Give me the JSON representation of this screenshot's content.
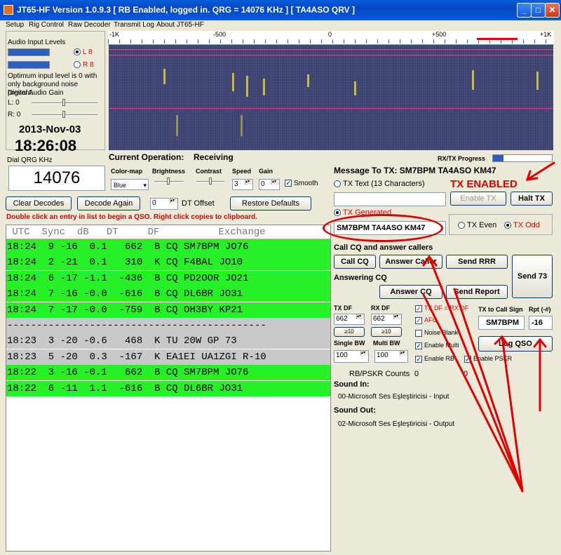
{
  "window": {
    "title": "JT65-HF Version 1.0.9.3  [ RB Enabled, logged in.  QRG = 14076 KHz ] [ TA4ASO QRV ]"
  },
  "menu": [
    "Setup",
    "Rig Control",
    "Raw Decoder",
    "Transmit Log",
    "About JT65-HF"
  ],
  "spectrum": {
    "ticks": [
      "-1K",
      "-500",
      "0",
      "+500",
      "+1K"
    ]
  },
  "audio": {
    "title": "Audio Input Levels",
    "left_label": "L 8",
    "right_label": "R 8",
    "hint": "Optimum input level is 0 with only background noise present.",
    "gain_title": "Digital Audio Gain",
    "gain_l": "L: 0",
    "gain_r": "R: 0"
  },
  "clock": {
    "date": "2013-Nov-03",
    "time": "18:26:08"
  },
  "dial": {
    "label": "Dial QRG KHz",
    "value": "14076"
  },
  "operation": {
    "label": "Current Operation:",
    "value": "Receiving"
  },
  "controls": {
    "colormap_label": "Color-map",
    "colormap_value": "Blue",
    "brightness_label": "Brightness",
    "contrast_label": "Contrast",
    "speed_label": "Speed",
    "speed_value": "3",
    "gain_label": "Gain",
    "gain_value": "0",
    "smooth_label": "Smooth"
  },
  "buttons": {
    "clear_decodes": "Clear Decodes",
    "decode_again": "Decode Again",
    "dt_offset_value": "0",
    "dt_offset_label": "DT Offset",
    "restore_defaults": "Restore Defaults"
  },
  "hint_line": "Double click an entry in list to begin a QSO.  Right click copies to clipboard.",
  "decode_header": " UTC  Sync  dB   DT     DF          Exchange",
  "decodes": [
    {
      "text": "18:24  9 -16  0.1   662  B CQ SM7BPM JO76",
      "style": "green"
    },
    {
      "text": "18:24  2 -21  0.1   310  K CQ F4BAL JO10",
      "style": "green"
    },
    {
      "text": "18:24  6 -17 -1.1  -436  B CQ PD2OOR JO21",
      "style": "green"
    },
    {
      "text": "18:24  7 -16 -0.0  -616  B CQ DL6BR JO31",
      "style": "green"
    },
    {
      "text": "18:24  7 -17 -0.0  -759  B CQ OH3BY KP21",
      "style": "green"
    },
    {
      "text": "--------------------------------------------",
      "style": "gray"
    },
    {
      "text": "18:23  3 -20 -0.6   468  K TU 20W GP 73",
      "style": "gray"
    },
    {
      "text": "18:23  5 -20  0.3  -167  K EA1EI UA1ZGI R-10",
      "style": "gray"
    },
    {
      "text": "18:22  3 -16 -0.1   662  B CQ SM7BPM JO76",
      "style": "green"
    },
    {
      "text": "18:22  6 -11  1.1  -616  B CQ DL6BR JO31",
      "style": "green"
    }
  ],
  "tx": {
    "progress_label": "RX/TX Progress",
    "message_label": "Message To TX: SM7BPM TA4ASO KM47",
    "tx_text_label": "TX Text (13 Characters)",
    "tx_enabled_annotation": "TX ENABLED",
    "enable_tx": "Enable TX",
    "halt_tx": "Halt TX",
    "tx_generated_label": "TX Generated",
    "generated_message": "SM7BPM TA4ASO KM47",
    "tx_even": "TX Even",
    "tx_odd": "TX Odd",
    "cq_section": "Call CQ and answer callers",
    "call_cq": "Call CQ",
    "answer_caller": "Answer Caller",
    "send_rrr": "Send RRR",
    "send_73": "Send 73",
    "answering_section": "Answering CQ",
    "answer_cq": "Answer CQ",
    "send_report": "Send Report",
    "tx_df_label": "TX DF",
    "tx_df_value": "662",
    "rx_df_label": "RX DF",
    "rx_df_value": "662",
    "df_button": "≥10",
    "tx_df_eq_rx_df": "TX DF = RX DF",
    "afc": "AFC",
    "noise_blank": "Noise Blank",
    "enable_multi": "Enable Multi",
    "enable_rb": "Enable RB",
    "enable_pskr": "Enable PSKR",
    "single_bw_label": "Single BW",
    "single_bw_value": "100",
    "multi_bw_label": "Multi BW",
    "multi_bw_value": "100",
    "tx_to_call_label": "TX to Call Sign",
    "tx_to_call_value": "SM7BPM",
    "rpt_label": "Rpt (-#)",
    "rpt_value": "-16",
    "log_qso": "Log QSO",
    "rb_counts_label": "RB/PSKR Counts",
    "rb_count": "0",
    "pskr_count": "0",
    "sound_in_label": "Sound In:",
    "sound_in_value": "00-Microsoft Ses Eşleştiricisi - Input",
    "sound_out_label": "Sound Out:",
    "sound_out_value": "02-Microsoft Ses Eşleştiricisi - Output"
  },
  "colors": {
    "decode_green": "#26f026",
    "annotation_red": "#e00000"
  }
}
